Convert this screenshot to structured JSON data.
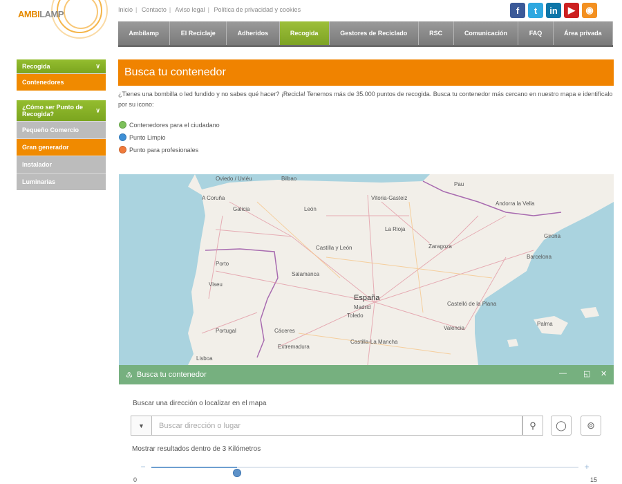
{
  "logo": {
    "part_a": "AMBI",
    "part_b": "LAMP"
  },
  "top_links": [
    "Inicio",
    "Contacto",
    "Aviso legal",
    "Política de privacidad y cookies"
  ],
  "social": [
    {
      "icon": "facebook-icon",
      "glyph": "f",
      "color": "#3b5998"
    },
    {
      "icon": "twitter-icon",
      "glyph": "t",
      "color": "#2fa8e0"
    },
    {
      "icon": "linkedin-icon",
      "glyph": "in",
      "color": "#0e76a8"
    },
    {
      "icon": "youtube-icon",
      "glyph": "▶",
      "color": "#cc2020"
    },
    {
      "icon": "rss-icon",
      "glyph": "◉",
      "color": "#f39020"
    }
  ],
  "nav": [
    "Ambilamp",
    "El Reciclaje",
    "Adheridos",
    "Recogida",
    "Gestores de Reciclado",
    "RSC",
    "Comunicación",
    "FAQ",
    "Área privada"
  ],
  "nav_active_index": 3,
  "sidebar": {
    "group1": {
      "title": "Recogida",
      "items": [
        "Contenedores"
      ]
    },
    "group2": {
      "title": "¿Cómo ser Punto de Recogida?",
      "items": [
        "Pequeño Comercio",
        "Gran generador",
        "Instalador",
        "Luminarias"
      ]
    }
  },
  "main": {
    "title": "Busca tu contenedor",
    "intro": "¿Tienes una bombilla o led fundido y no sabes qué hacer? ¡Recicla! Tenemos más de 35.000 puntos de recogida. Busca tu contenedor más cercano en nuestro mapa e identifícalo por su icono:",
    "legend": [
      {
        "label": "Contenedores para el ciudadano",
        "color": "#7cc05a"
      },
      {
        "label": "Punto Limpio",
        "color": "#3d8fd6"
      },
      {
        "label": "Punto para profesionales",
        "color": "#f07a3a"
      }
    ]
  },
  "map": {
    "cities": [
      "Oviedo / Uviéu",
      "A Coruña",
      "Bilbao",
      "Pau",
      "Vitoria-Gasteiz",
      "Galicia",
      "León",
      "Andorra la Vella",
      "La Rioja",
      "Girona",
      "Zaragoza",
      "Castilla y León",
      "Porto",
      "Barcelona",
      "Viseu",
      "Salamanca",
      "España",
      "Madrid",
      "Castelló de la Plana",
      "Toledo",
      "Palma",
      "Portugal",
      "Cáceres",
      "Extremadura",
      "Castilla-La Mancha",
      "Valencia",
      "Lisboa"
    ],
    "water_color": "#aad3df",
    "land_color": "#f2efe9"
  },
  "panel": {
    "title": "Busca tu contenedor",
    "minimize": "—",
    "maximize": "◱",
    "close": "✕"
  },
  "search": {
    "label": "Buscar una dirección o localizar en el mapa",
    "placeholder": "Buscar dirección o lugar",
    "value": ""
  },
  "range": {
    "label": "Mostrar resultados dentro de 3 Kilómetros",
    "value": 3,
    "min": 0,
    "max": 15,
    "min_label": "0",
    "max_label": "15"
  }
}
